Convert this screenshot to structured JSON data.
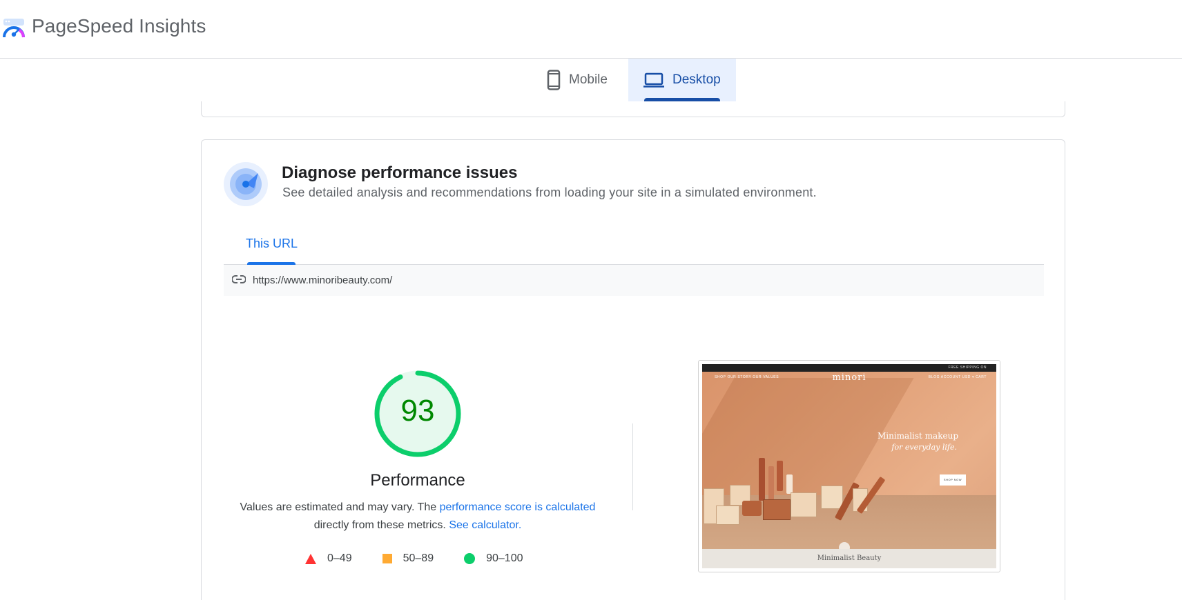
{
  "app": {
    "title": "PageSpeed Insights"
  },
  "device_tabs": {
    "mobile_label": "Mobile",
    "desktop_label": "Desktop",
    "selected": "Desktop"
  },
  "diagnose": {
    "title": "Diagnose performance issues",
    "subtitle": "See detailed analysis and recommendations from loading your site in a simulated environment.",
    "tab_label": "This URL",
    "url": "https://www.minoribeauty.com/"
  },
  "score": {
    "value": "93",
    "gauge_fraction": 0.93,
    "label": "Performance",
    "note_prefix": "Values are estimated and may vary. The ",
    "note_link": "performance score is calculated",
    "note_middle": " directly from these metrics. ",
    "note_calc_link": "See calculator.",
    "legend": {
      "fail": "0–49",
      "average": "50–89",
      "pass": "90–100"
    }
  },
  "colors": {
    "pass": "#0cce6b",
    "average": "#ffaa33",
    "fail": "#ff3333",
    "accent": "#1a73e8",
    "desktop_tab_bg": "#e8f0fe"
  },
  "screenshot": {
    "topbar_text": "FREE SHIPPING ON",
    "nav_left": "SHOP    OUR STORY    OUR VALUES",
    "brand": "minori",
    "nav_right": "BLOG    ACCOUNT    USD ▾    CART",
    "headline_1": "Minimalist makeup",
    "headline_2": "for everyday life.",
    "button": "SHOP NOW",
    "footer": "Minimalist Beauty"
  }
}
